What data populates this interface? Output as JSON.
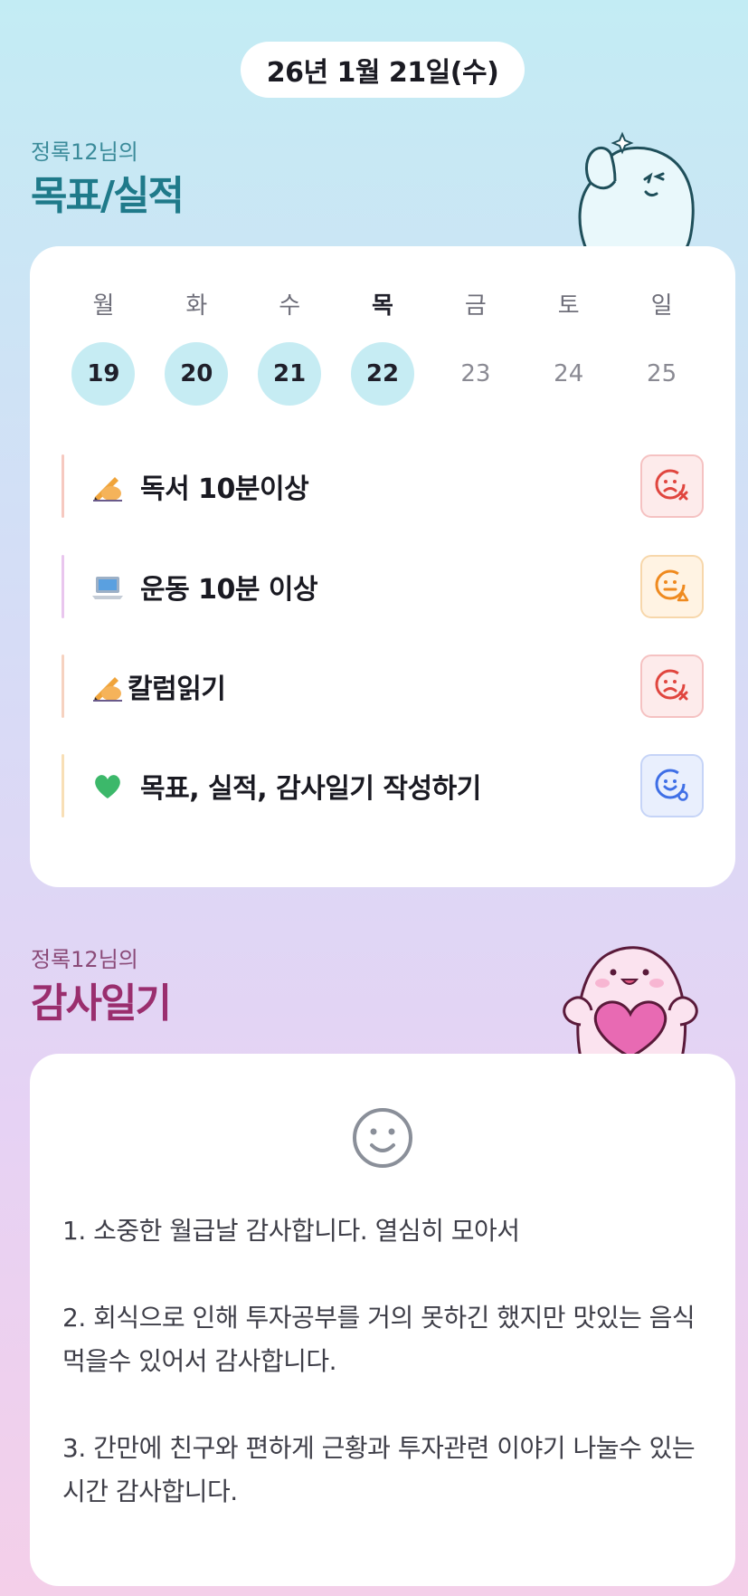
{
  "date_label": "26년 1월 21일(수)",
  "goals_section": {
    "subtitle": "정록12님의",
    "title": "목표/실적",
    "weekdays": [
      "월",
      "화",
      "수",
      "목",
      "금",
      "토",
      "일"
    ],
    "dates": [
      "19",
      "20",
      "21",
      "22",
      "23",
      "24",
      "25"
    ],
    "items": [
      {
        "emoji": "writing-hand-icon",
        "label": "독서 10분이상",
        "status": "x",
        "bar_color": "#f6c9c0"
      },
      {
        "emoji": "laptop-icon",
        "label": "운동 10분 이상",
        "status": "triangle",
        "bar_color": "#e9c6ee"
      },
      {
        "emoji": "writing-hand-icon",
        "label": "칼럼읽기",
        "status": "x",
        "bar_color": "#f6d2c0"
      },
      {
        "emoji": "green-heart-icon",
        "label": "목표, 실적, 감사일기 작성하기",
        "status": "o",
        "bar_color": "#f8dfb6"
      }
    ]
  },
  "gratitude_section": {
    "subtitle": "정록12님의",
    "title": "감사일기",
    "entries": [
      "1. 소중한 월급날 감사합니다. 열심히 모아서",
      "2. 회식으로 인해 투자공부를 거의 못하긴 했지만 맛있는 음식 먹을수 있어서 감사합니다.",
      "3. 간만에 친구와 편하게 근황과 투자관련 이야기 나눌수 있는 시간 감사합니다."
    ]
  },
  "colors": {
    "accent_teal": "#1f7a8a",
    "accent_plum": "#9a2e6e",
    "status_x": "#e0463f",
    "status_triangle": "#ef8a1f",
    "status_o": "#3f6fe6"
  }
}
